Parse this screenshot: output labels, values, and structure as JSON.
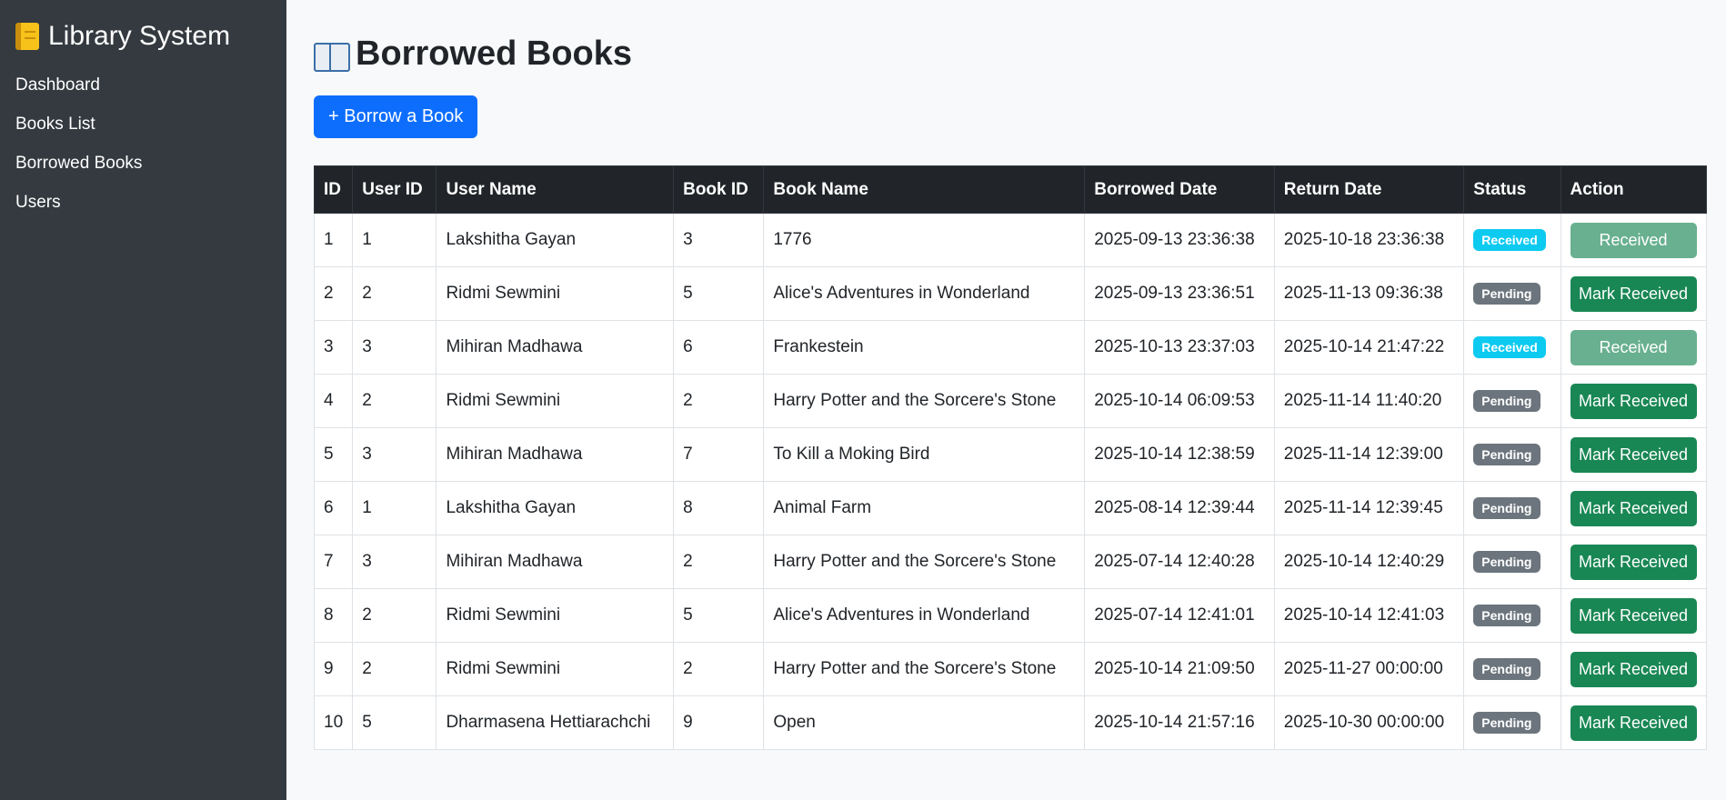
{
  "sidebar": {
    "brand": "Library System",
    "brand_icon": "notebook-icon",
    "items": [
      {
        "label": "Dashboard"
      },
      {
        "label": "Books List"
      },
      {
        "label": "Borrowed Books"
      },
      {
        "label": "Users"
      }
    ]
  },
  "main": {
    "title": "Borrowed Books",
    "title_icon": "open-book-icon",
    "borrow_button": "+ Borrow a Book"
  },
  "table": {
    "headers": [
      "ID",
      "User ID",
      "User Name",
      "Book ID",
      "Book Name",
      "Borrowed Date",
      "Return Date",
      "Status",
      "Action"
    ],
    "rows": [
      {
        "id": "1",
        "user_id": "1",
        "user_name": "Lakshitha Gayan",
        "book_id": "3",
        "book_name": "1776",
        "borrowed": "2025-09-13 23:36:38",
        "returned": "2025-10-18 23:36:38",
        "status": "Received",
        "action": "Received"
      },
      {
        "id": "2",
        "user_id": "2",
        "user_name": "Ridmi Sewmini",
        "book_id": "5",
        "book_name": "Alice's Adventures in Wonderland",
        "borrowed": "2025-09-13 23:36:51",
        "returned": "2025-11-13 09:36:38",
        "status": "Pending",
        "action": "Mark Received"
      },
      {
        "id": "3",
        "user_id": "3",
        "user_name": "Mihiran Madhawa",
        "book_id": "6",
        "book_name": "Frankestein",
        "borrowed": "2025-10-13 23:37:03",
        "returned": "2025-10-14 21:47:22",
        "status": "Received",
        "action": "Received"
      },
      {
        "id": "4",
        "user_id": "2",
        "user_name": "Ridmi Sewmini",
        "book_id": "2",
        "book_name": "Harry Potter and the Sorcere's Stone",
        "borrowed": "2025-10-14 06:09:53",
        "returned": "2025-11-14 11:40:20",
        "status": "Pending",
        "action": "Mark Received"
      },
      {
        "id": "5",
        "user_id": "3",
        "user_name": "Mihiran Madhawa",
        "book_id": "7",
        "book_name": "To Kill a Moking Bird",
        "borrowed": "2025-10-14 12:38:59",
        "returned": "2025-11-14 12:39:00",
        "status": "Pending",
        "action": "Mark Received"
      },
      {
        "id": "6",
        "user_id": "1",
        "user_name": "Lakshitha Gayan",
        "book_id": "8",
        "book_name": "Animal Farm",
        "borrowed": "2025-08-14 12:39:44",
        "returned": "2025-11-14 12:39:45",
        "status": "Pending",
        "action": "Mark Received"
      },
      {
        "id": "7",
        "user_id": "3",
        "user_name": "Mihiran Madhawa",
        "book_id": "2",
        "book_name": "Harry Potter and the Sorcere's Stone",
        "borrowed": "2025-07-14 12:40:28",
        "returned": "2025-10-14 12:40:29",
        "status": "Pending",
        "action": "Mark Received"
      },
      {
        "id": "8",
        "user_id": "2",
        "user_name": "Ridmi Sewmini",
        "book_id": "5",
        "book_name": "Alice's Adventures in Wonderland",
        "borrowed": "2025-07-14 12:41:01",
        "returned": "2025-10-14 12:41:03",
        "status": "Pending",
        "action": "Mark Received"
      },
      {
        "id": "9",
        "user_id": "2",
        "user_name": "Ridmi Sewmini",
        "book_id": "2",
        "book_name": "Harry Potter and the Sorcere's Stone",
        "borrowed": "2025-10-14 21:09:50",
        "returned": "2025-11-27 00:00:00",
        "status": "Pending",
        "action": "Mark Received"
      },
      {
        "id": "10",
        "user_id": "5",
        "user_name": "Dharmasena Hettiarachchi",
        "book_id": "9",
        "book_name": "Open",
        "borrowed": "2025-10-14 21:57:16",
        "returned": "2025-10-30 00:00:00",
        "status": "Pending",
        "action": "Mark Received"
      }
    ]
  },
  "colors": {
    "sidebar_bg": "#343a40",
    "primary": "#0d6efd",
    "success": "#198754",
    "info": "#0dcaf0",
    "secondary": "#6c757d",
    "table_head": "#212529"
  }
}
